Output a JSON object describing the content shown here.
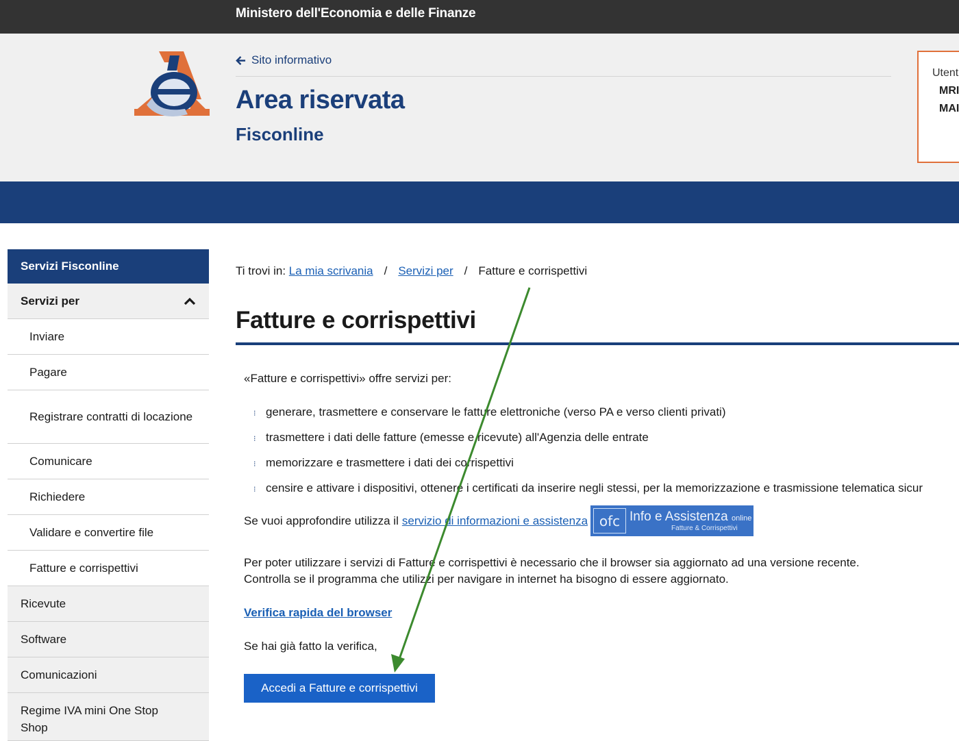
{
  "topbar": {
    "ministry": "Ministero dell'Economia e delle Finanze"
  },
  "header": {
    "back_link": "Sito informativo",
    "title": "Area riservata",
    "subtitle": "Fisconline",
    "user_box": {
      "line1": "Utent",
      "line2": "MRI",
      "line3": "MAI"
    }
  },
  "sidebar": {
    "heading": "Servizi Fisconline",
    "group": "Servizi per",
    "sub_items": [
      {
        "label": "Inviare"
      },
      {
        "label": "Pagare"
      },
      {
        "label": "Registrare contratti di locazione"
      },
      {
        "label": "Comunicare"
      },
      {
        "label": "Richiedere"
      },
      {
        "label": "Validare e convertire file"
      },
      {
        "label": "Fatture e corrispettivi"
      }
    ],
    "top_items": [
      {
        "label": "Ricevute"
      },
      {
        "label": "Software"
      },
      {
        "label": "Comunicazioni"
      },
      {
        "label": "Regime IVA mini One Stop Shop"
      }
    ]
  },
  "breadcrumb": {
    "prefix": "Ti trovi in:",
    "link1": "La mia scrivania",
    "separator": "/",
    "link2": "Servizi per",
    "current": "Fatture e corrispettivi"
  },
  "main": {
    "title": "Fatture e corrispettivi",
    "intro": "«Fatture e corrispettivi» offre servizi per:",
    "bullets": [
      "generare, trasmettere e conservare le fatture elettroniche (verso PA e verso clienti privati)",
      "trasmettere i dati delle fatture (emesse e ricevute) all'Agenzia delle entrate",
      "memorizzare e trasmettere i dati dei corrispettivi",
      "censire e attivare i dispositivi, ottenere i certificati da inserire negli stessi, per la memorizzazione e trasmissione telematica sicur"
    ],
    "approf_text": "Se vuoi approfondire utilizza il",
    "approf_link": "servizio di informazioni e assistenza",
    "info_badge": {
      "logo": "ofc",
      "title": "Info e Assistenza",
      "title_small": "online",
      "subtitle": "Fatture & Corrispettivi"
    },
    "browser_note_1": "Per poter utilizzare i servizi di Fatture e corrispettivi è necessario che il browser sia aggiornato ad una versione recente.",
    "browser_note_2": "Controlla se il programma che utilizzi per navigare in internet ha bisogno di essere aggiornato.",
    "verify_link": "Verifica rapida del browser",
    "already_text": "Se hai già fatto la verifica,",
    "access_button": "Accedi a Fatture e corrispettivi"
  },
  "colors": {
    "brand_blue": "#1a3f7a",
    "button_blue": "#1a62c7",
    "link_blue": "#1a5fb4",
    "logo_orange": "#e0703a",
    "annotation_arrow": "#3c8a2e"
  },
  "icons": {
    "back": "arrow-left-icon",
    "collapse": "chevron-up-icon",
    "bullet": "dots-bullet-icon"
  }
}
